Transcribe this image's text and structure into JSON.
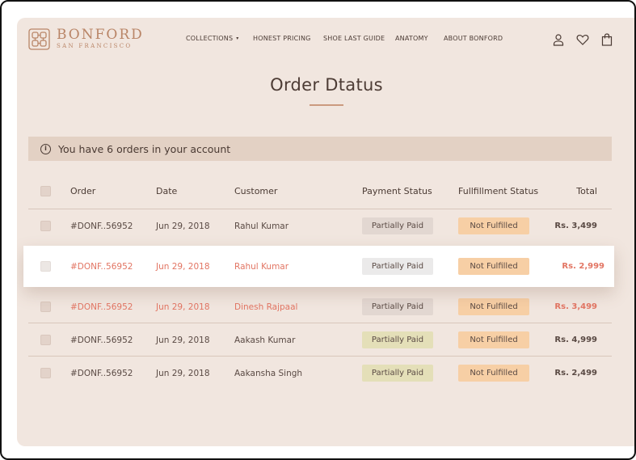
{
  "brand": {
    "name": "BONFORD",
    "subtitle": "SAN FRANCISCO"
  },
  "nav": {
    "items": [
      {
        "label": "COLLECTIONS",
        "has_caret": true
      },
      {
        "label": "HONEST PRICING"
      },
      {
        "label": "SHOE LAST GUIDE"
      },
      {
        "label": "ANATOMY"
      },
      {
        "label": "ABOUT BONFORD"
      }
    ],
    "caret": "▾"
  },
  "header_icons": [
    "user-icon",
    "heart-icon",
    "shopping-bag-icon"
  ],
  "page": {
    "title": "Order Dtatus"
  },
  "info": {
    "icon": "i",
    "text": "You have 6 orders in your account"
  },
  "table": {
    "headers": {
      "order": "Order",
      "date": "Date",
      "customer": "Customer",
      "payment": "Payment Status",
      "fulfillment": "Fullfillment Status",
      "total": "Total"
    },
    "rows": [
      {
        "order": "#DONF..56952",
        "date": "Jun 29, 2018",
        "customer": "Rahul Kumar",
        "payment": "Partially Paid",
        "fulfillment": "Not Fulfilled",
        "total": "Rs. 3,499"
      },
      {
        "order": "#DONF..56952",
        "date": "Jun 29, 2018",
        "customer": "Rahul Kumar",
        "payment": "Partially Paid",
        "fulfillment": "Not Fulfilled",
        "total": "Rs. 2,999"
      },
      {
        "order": "#DONF..56952",
        "date": "Jun 29, 2018",
        "customer": "Dinesh Rajpaal",
        "payment": "Partially Paid",
        "fulfillment": "Not Fulfilled",
        "total": "Rs. 3,499"
      },
      {
        "order": "#DONF..56952",
        "date": "Jun 29, 2018",
        "customer": "Aakash Kumar",
        "payment": "Partially Paid",
        "fulfillment": "Not Fulfilled",
        "total": "Rs. 4,999"
      },
      {
        "order": "#DONF..56952",
        "date": "Jun 29, 2018",
        "customer": "Aakansha Singh",
        "payment": "Partially Paid",
        "fulfillment": "Not Fulfilled",
        "total": "Rs. 2,499"
      }
    ]
  },
  "colors": {
    "background": "#f1e6df",
    "accent": "#b98567",
    "highlight_text": "#e27563",
    "badge_fulfillment": "#f7cfa5",
    "badge_paid_green": "#e4dfb8",
    "badge_paid_grey": "#e2d7d1",
    "info_bar": "#e3d1c4"
  }
}
